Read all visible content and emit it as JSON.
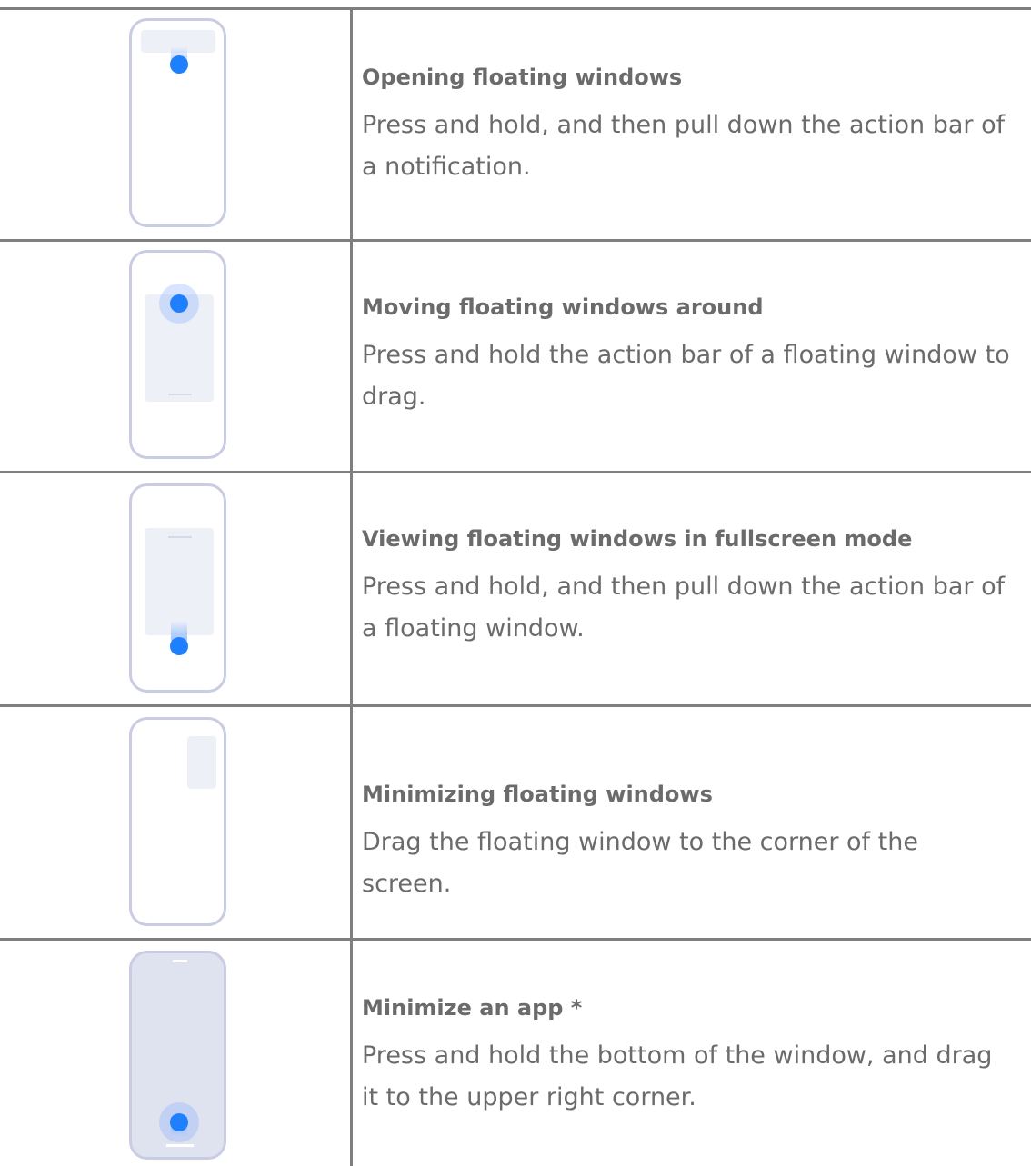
{
  "rows": [
    {
      "title": "Opening floating windows",
      "description": "Press and hold, and then pull down the action bar of a notification.",
      "icon": "notification-pull-down-icon"
    },
    {
      "title": "Moving floating windows around",
      "description": "Press and hold the action bar of a floating window to drag.",
      "icon": "floating-window-move-icon"
    },
    {
      "title": "Viewing floating windows in fullscreen mode",
      "description": "Press and hold, and then pull down the action bar of a floating window.",
      "icon": "floating-window-fullscreen-icon"
    },
    {
      "title": "Minimizing floating windows",
      "description": "Drag the floating window to the corner of the screen.",
      "icon": "floating-window-minimize-icon"
    },
    {
      "title": "Minimize an app *",
      "description": "Press and hold the bottom of the window, and drag it to the upper right corner.",
      "icon": "app-minimize-icon"
    }
  ],
  "colors": {
    "border": "#7f7f7f",
    "phone_outline": "#c9cce3",
    "touch_dot": "#1e80ff",
    "text": "#6b6b6b"
  }
}
